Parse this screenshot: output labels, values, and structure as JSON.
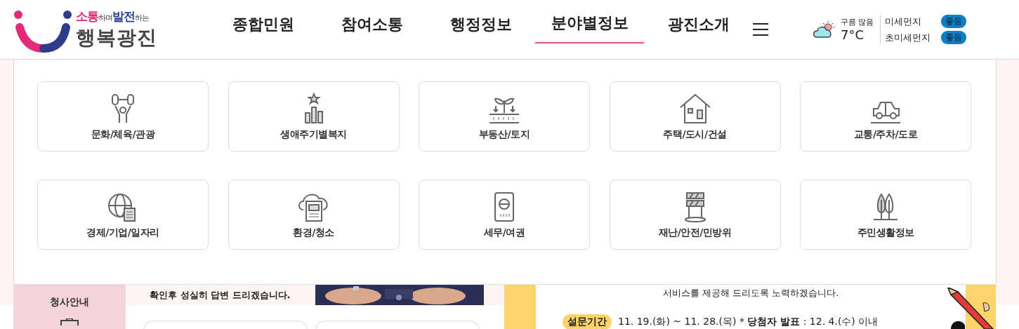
{
  "header": {
    "logo": {
      "tagline": "**소통**하며**발전**하는",
      "name": "행복광진"
    },
    "nav": [
      {
        "label": "종합민원",
        "selected": false
      },
      {
        "label": "참여소통",
        "selected": false
      },
      {
        "label": "행정정보",
        "selected": false
      },
      {
        "label": "분야별정보",
        "selected": true
      },
      {
        "label": "광진소개",
        "selected": false
      }
    ],
    "weather": {
      "condition": "구름 많음",
      "temperature": "7°C"
    },
    "air_quality": [
      {
        "label": "미세먼지",
        "grade": "좋음"
      },
      {
        "label": "초미세먼지",
        "grade": "좋음"
      }
    ]
  },
  "mega_menu": {
    "items": [
      "문화/체육/관광",
      "생애주기별복지",
      "부동산/토지",
      "주택/도시/건설",
      "교통/주차/도로",
      "경제/기업/일자리",
      "환경/청소",
      "세무/여권",
      "재난/안전/민방위",
      "주민생활정보"
    ]
  },
  "page_behind": {
    "sidebar_item": "청사안내",
    "notice_text": "확인후 성실히 답변 드리겠습니다.",
    "survey_text": "서비스를 제공해 드리도록 노력하겠습니다.",
    "survey_badge": "설문기간",
    "survey_period": "11. 19.(화) ~ 11. 28.(목) * **당첨자 발표** : 12. 4.(수) 이내"
  }
}
